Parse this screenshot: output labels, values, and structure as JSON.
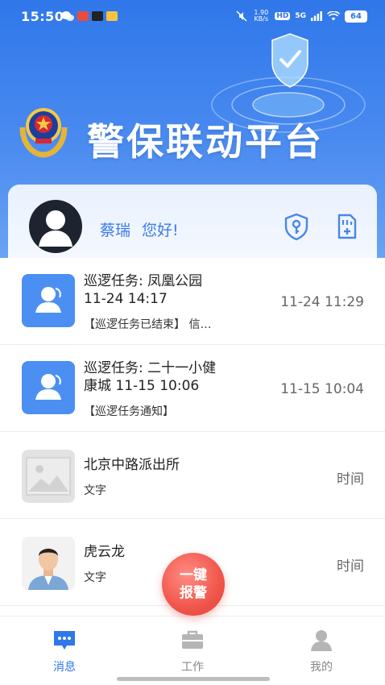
{
  "status_bar": {
    "time": "15:50",
    "net_speed": "1.90 KB/s",
    "hd": "HD",
    "signal": "5G",
    "battery": "64"
  },
  "header": {
    "title": "警保联动平台"
  },
  "user_card": {
    "name": "蔡瑞",
    "greeting": "您好!"
  },
  "messages": [
    {
      "title_line1": "巡逻任务: 凤凰公园",
      "title_line2": "11-24 14:17",
      "subtitle": "【巡逻任务已结束】 信…",
      "time": "11-24 11:29",
      "icon": "person-icon"
    },
    {
      "title_line1": "巡逻任务: 二十一小健",
      "title_line2": "康城  11-15 10:06",
      "subtitle": "【巡逻任务通知】",
      "time": "11-15 10:04",
      "icon": "person-icon"
    },
    {
      "title_line1": "北京中路派出所",
      "subtitle": "文字",
      "time": "时间",
      "icon": "image-placeholder-icon"
    },
    {
      "title_line1": "虎云龙",
      "subtitle": "文字",
      "time": "时间",
      "icon": "officer-photo"
    }
  ],
  "sos_button": {
    "line1": "一键",
    "line2": "报警"
  },
  "tabs": [
    {
      "label": "消息",
      "active": true
    },
    {
      "label": "工作",
      "active": false
    },
    {
      "label": "我的",
      "active": false
    }
  ],
  "colors": {
    "primary": "#2f77ea",
    "header_light": "#6aa3f4",
    "sos": "#f0564b",
    "icon_blue": "#4c8ff2"
  }
}
